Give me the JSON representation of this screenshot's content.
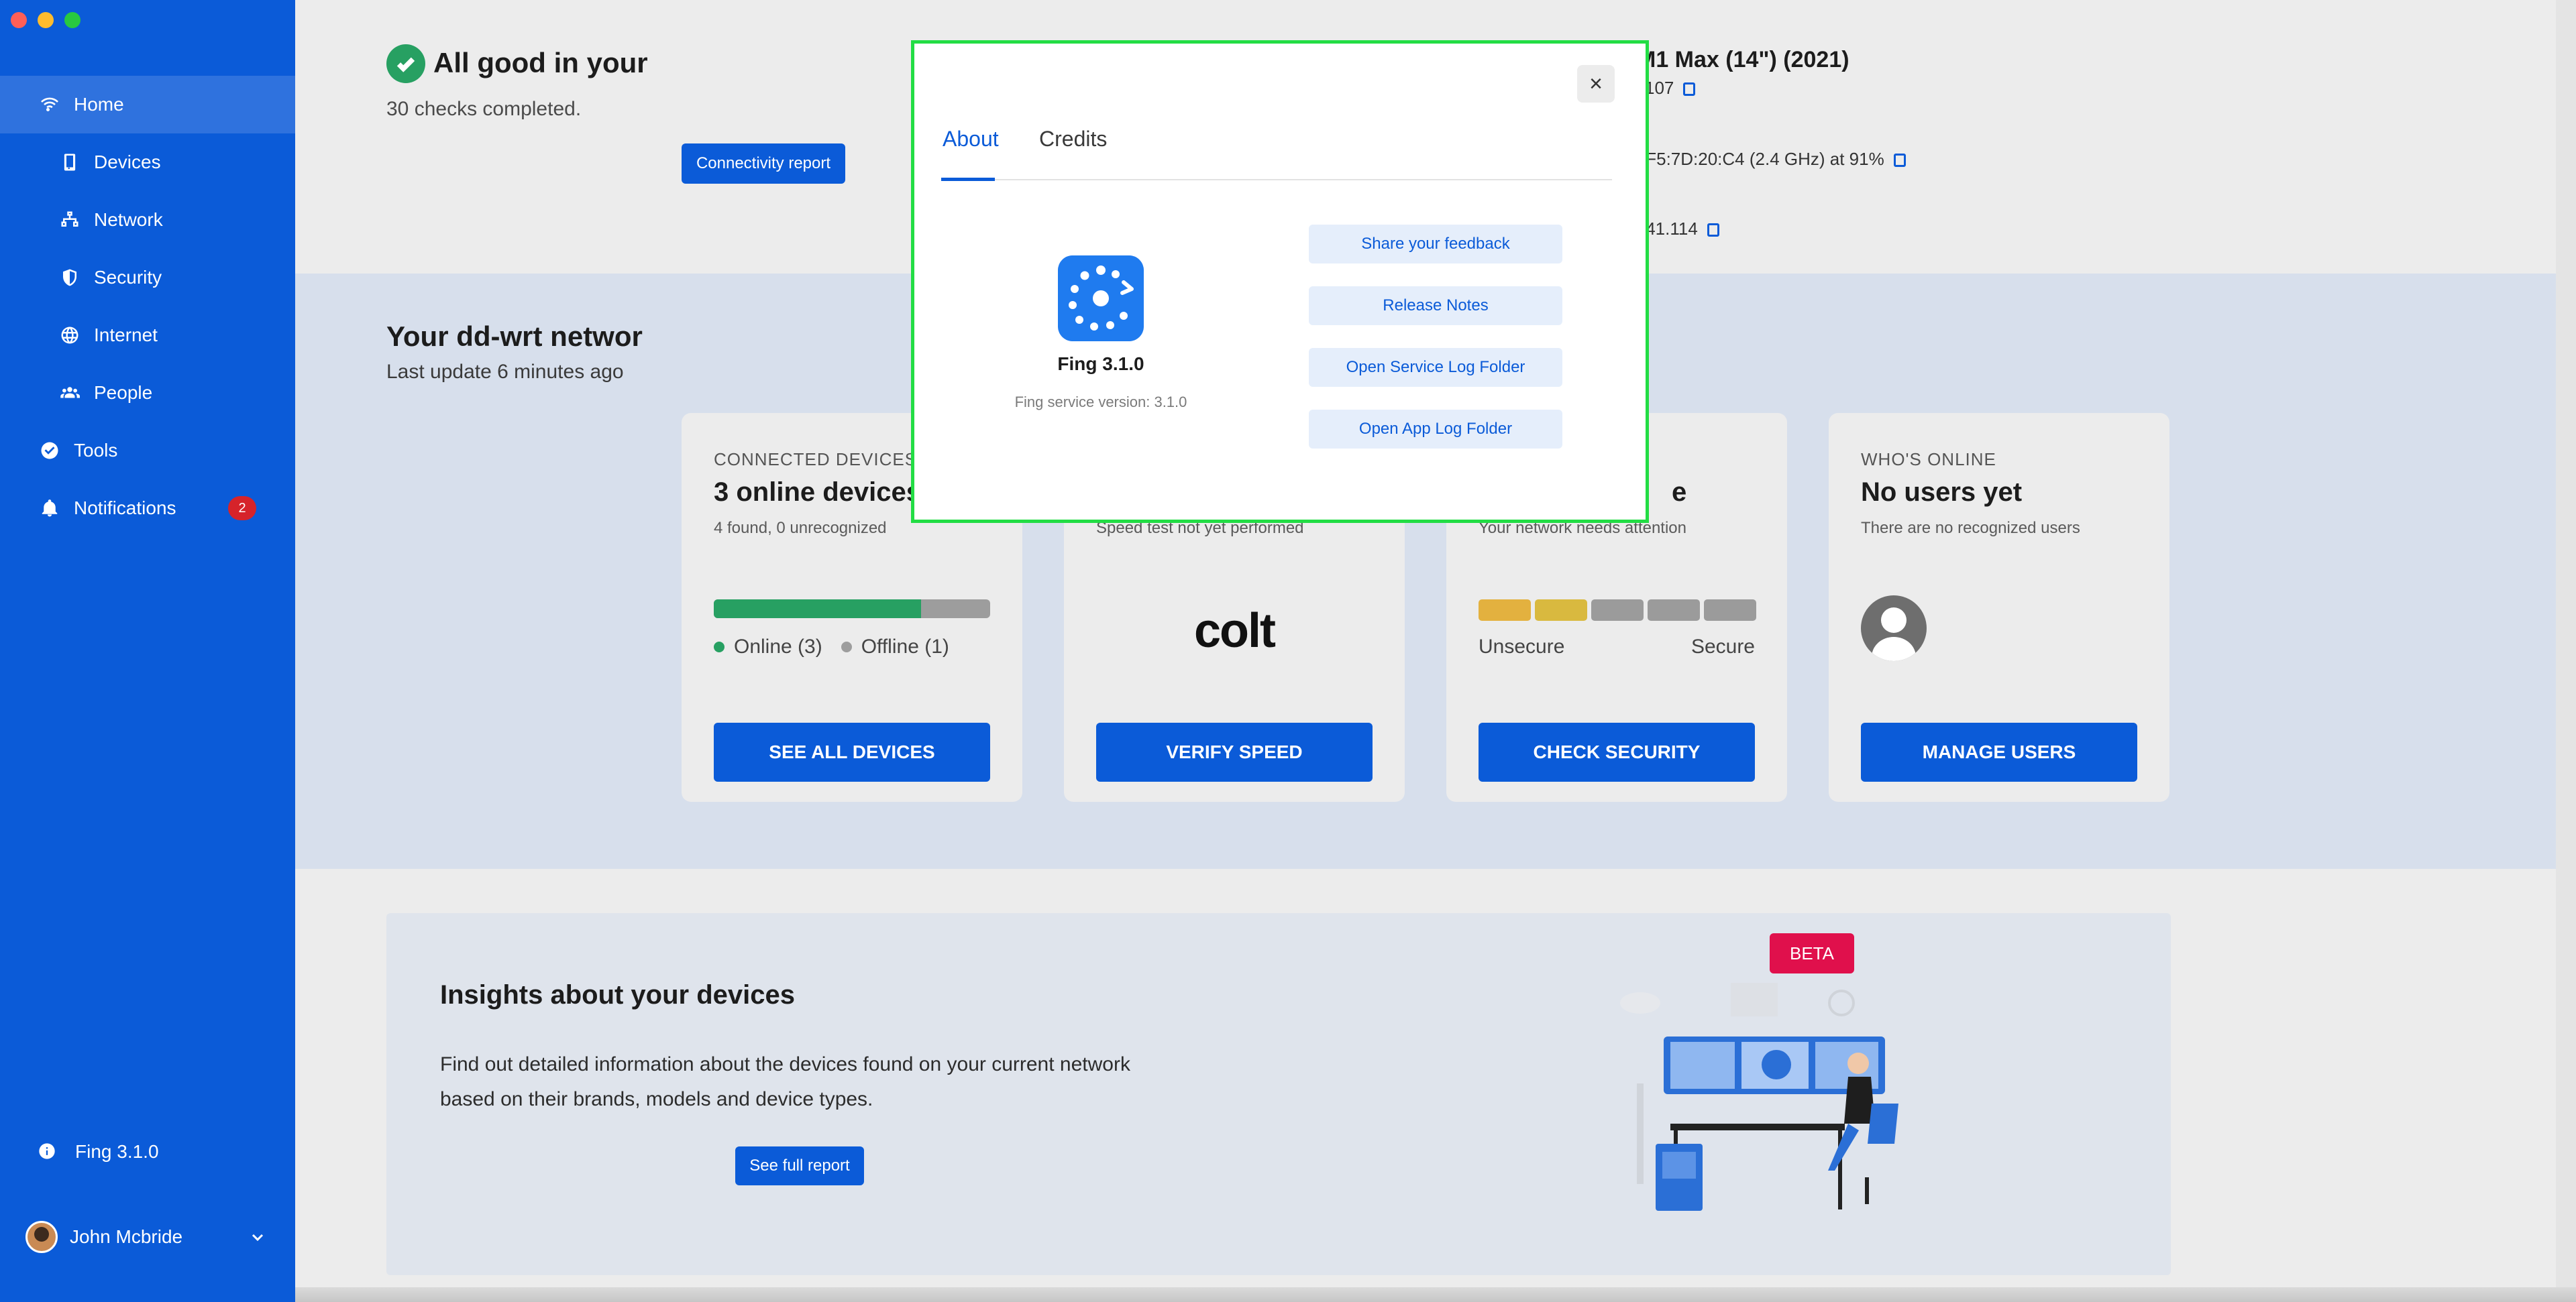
{
  "sidebar": {
    "items": [
      {
        "label": "Home",
        "icon": "wifi-icon"
      },
      {
        "label": "Devices",
        "icon": "phone-icon"
      },
      {
        "label": "Network",
        "icon": "network-icon"
      },
      {
        "label": "Security",
        "icon": "shield-icon"
      },
      {
        "label": "Internet",
        "icon": "globe-icon"
      },
      {
        "label": "People",
        "icon": "people-icon"
      },
      {
        "label": "Tools",
        "icon": "check-circle-icon"
      },
      {
        "label": "Notifications",
        "icon": "bell-icon",
        "badge": "2"
      }
    ],
    "version_label": "Fing 3.1.0",
    "user_name": "John Mcbride"
  },
  "status": {
    "title": "All good in your",
    "subtitle": "30 checks completed.",
    "button": "Connectivity report",
    "device_model": "M1 Max (14\") (2021)",
    "device_detail": "107",
    "wifi_detail": ":F5:7D:20:C4 (2.4 GHz) at 91%",
    "ip_detail": ".41.114"
  },
  "network": {
    "title": "Your dd-wrt networ",
    "subtitle": "Last update 6 minutes ago"
  },
  "cards": {
    "devices": {
      "kicker": "CONNECTED DEVICES",
      "title": "3 online devices",
      "sub": "4 found, 0 unrecognized",
      "online_fraction": 0.75,
      "legend_online": "Online (3)",
      "legend_offline": "Offline (1)",
      "button": "SEE ALL DEVICES"
    },
    "speed": {
      "sub": "Speed test not yet performed",
      "logo": "colt",
      "button": "VERIFY SPEED"
    },
    "security": {
      "title_tail": "e",
      "sub": "Your network needs attention",
      "label_left": "Unsecure",
      "label_right": "Secure",
      "button": "CHECK SECURITY"
    },
    "users": {
      "kicker": "WHO'S ONLINE",
      "title": "No users yet",
      "sub": "There are no recognized users",
      "button": "MANAGE USERS"
    }
  },
  "insight": {
    "badge": "BETA",
    "title": "Insights about your devices",
    "body": "Find out detailed information about the devices found on your current network based on their brands, models and device types.",
    "button": "See full report"
  },
  "modal": {
    "close_label": "×",
    "tabs": [
      "About",
      "Credits"
    ],
    "app_name": "Fing 3.1.0",
    "service_version": "Fing service version: 3.1.0",
    "buttons": [
      "Share your feedback",
      "Release Notes",
      "Open Service Log Folder",
      "Open App Log Folder"
    ]
  },
  "colors": {
    "brand_blue": "#0b5bd8",
    "success_green": "#27a062",
    "highlight_border": "#22dd44",
    "beta_red": "#e0104c"
  }
}
